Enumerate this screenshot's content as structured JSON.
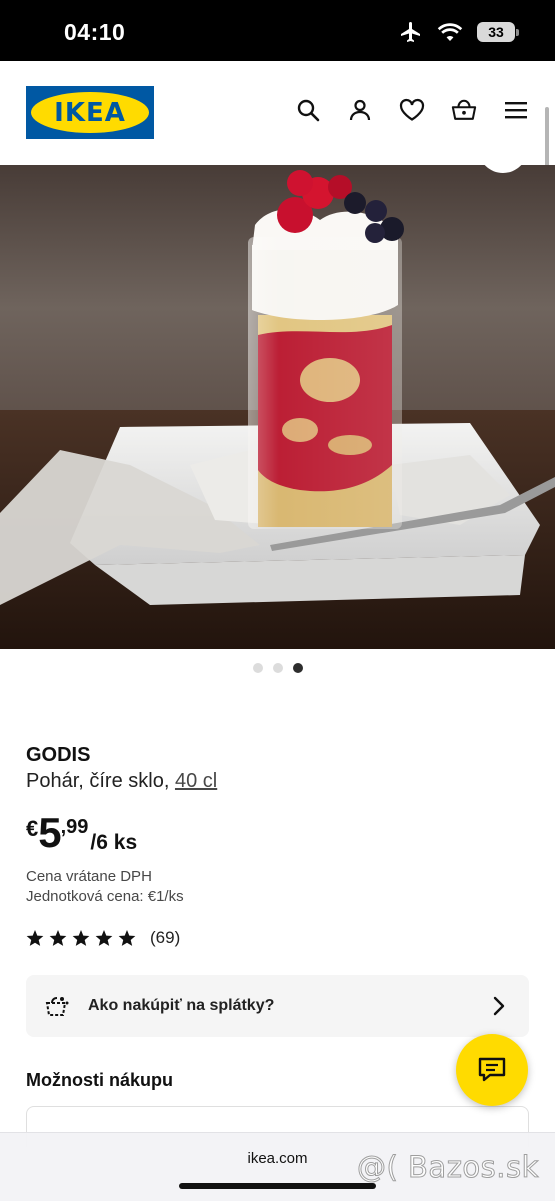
{
  "status_bar": {
    "time": "04:10",
    "battery": "33"
  },
  "header": {
    "logo_text": "IKEA",
    "icons": [
      "search-icon",
      "user-icon",
      "heart-icon",
      "basket-icon",
      "menu-icon"
    ]
  },
  "gallery": {
    "image_count": 3,
    "active_index": 2
  },
  "product": {
    "name": "GODIS",
    "desc_prefix": "Pohár, číre sklo, ",
    "desc_size": "40 cl",
    "price_currency": "€",
    "price_int": "5",
    "price_dec": ",99",
    "price_unit": "/6 ks",
    "vat_text": "Cena vrátane DPH",
    "unit_price": "Jednotková cena: €1/ks",
    "rating_stars": 5,
    "rating_count": "(69)"
  },
  "installments": {
    "label": "Ako nakúpiť na splátky?"
  },
  "buy_options": {
    "title": "Možnosti nákupu"
  },
  "browser": {
    "url": "ikea.com"
  },
  "watermark": "@( Bazos.sk",
  "colors": {
    "ikea_blue": "#0058a3",
    "ikea_yellow": "#ffdb00"
  }
}
